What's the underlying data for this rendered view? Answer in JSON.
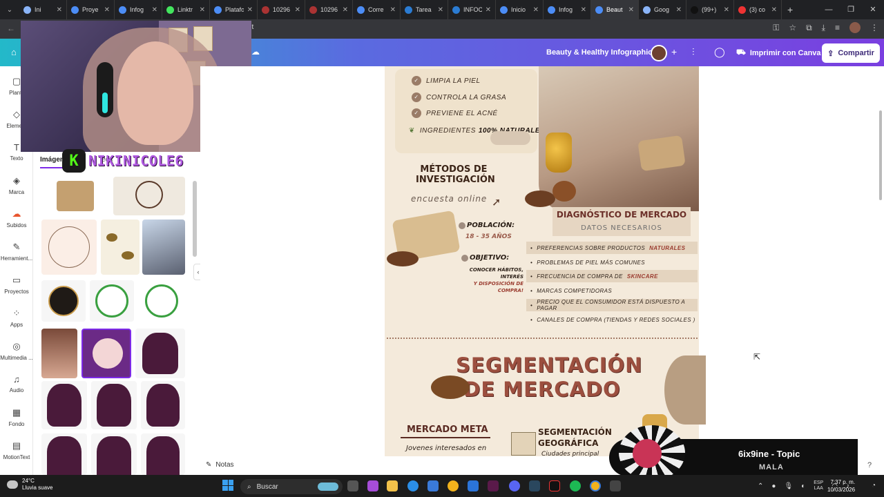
{
  "browser": {
    "tabs": [
      {
        "label": "Ini",
        "color": "#8ab4f8",
        "active": false
      },
      {
        "label": "Proye",
        "color": "#4c8df6",
        "active": false
      },
      {
        "label": "Infog",
        "color": "#4c8df6",
        "active": false
      },
      {
        "label": "Linktr",
        "color": "#43e55e",
        "active": false
      },
      {
        "label": "Platafo",
        "color": "#4c8df6",
        "active": false
      },
      {
        "label": "10296",
        "color": "#a33",
        "active": false
      },
      {
        "label": "10296",
        "color": "#a33",
        "active": false
      },
      {
        "label": "Corre",
        "color": "#4c8df6",
        "active": false
      },
      {
        "label": "Tarea",
        "color": "#2b7cd3",
        "active": false
      },
      {
        "label": "INFOC",
        "color": "#2b7cd3",
        "active": false
      },
      {
        "label": "Inicio",
        "color": "#4c8df6",
        "active": false
      },
      {
        "label": "Infog",
        "color": "#4c8df6",
        "active": false
      },
      {
        "label": "Beaut",
        "color": "#4c8df6",
        "active": true
      },
      {
        "label": "Goog",
        "color": "#8ab4f8",
        "active": false
      },
      {
        "label": "(99+)",
        "color": "#111",
        "active": false
      },
      {
        "label": "(3) co",
        "color": "#e33",
        "active": false
      }
    ],
    "url_fragment": "lit"
  },
  "canva": {
    "title": "Beauty & Healthy Infographic",
    "print_label": "Imprimir con Canva",
    "share_label": "Compartir",
    "notes_label": "Notas"
  },
  "rail": {
    "items": [
      {
        "name": "plantillas",
        "label": "Plantil",
        "icon": "▢"
      },
      {
        "name": "elementos",
        "label": "Element",
        "icon": "◇"
      },
      {
        "name": "texto",
        "label": "Texto",
        "icon": "T"
      },
      {
        "name": "marca",
        "label": "Marca",
        "icon": "◈"
      },
      {
        "name": "subidos",
        "label": "Subidos",
        "icon": "☁"
      },
      {
        "name": "herramientas",
        "label": "Herramient...",
        "icon": "✎"
      },
      {
        "name": "proyectos",
        "label": "Proyectos",
        "icon": "▭"
      },
      {
        "name": "apps",
        "label": "Apps",
        "icon": "⁘"
      },
      {
        "name": "multimedia",
        "label": "Multimedia ...",
        "icon": "◎"
      },
      {
        "name": "audio",
        "label": "Audio",
        "icon": "♫"
      },
      {
        "name": "fondo",
        "label": "Fondo",
        "icon": "▦"
      },
      {
        "name": "motiontext",
        "label": "MotionText",
        "icon": "▤"
      }
    ]
  },
  "stream": {
    "badge": "K",
    "name": "NIKINICOLE6"
  },
  "panel": {
    "tabs": [
      "Imágen",
      "eos"
    ]
  },
  "infographic": {
    "benefits": [
      "LIMPIA LA PIEL",
      "CONTROLA LA GRASA",
      "PREVIENE EL ACNÉ"
    ],
    "ingredients": "INGREDIENTES",
    "ingredients_bold": "100% NATURALES",
    "methods_title": "MÉTODOS DE INVESTIGACIÓN",
    "methods_sub": "encuesta online",
    "diag_title": "DIAGNÓSTICO DE MERCADO",
    "diag_sub": "DATOS NECESARIOS",
    "population_label": "POBLACIÓN:",
    "population_value": "18 - 35 AÑOS",
    "objective_label": "OBJETIVO:",
    "objective_value": "CONOCER HÁBITOS, INTERÉS",
    "objective_value_hl": "Y DISPOSICIÓN DE COMPRA!",
    "needs": [
      {
        "text": "PREFERENCIAS SOBRE PRODUCTOS",
        "hl": "NATURALES"
      },
      {
        "text": "PROBLEMAS DE PIEL MÁS COMUNES",
        "hl": ""
      },
      {
        "text": "FRECUENCIA DE COMPRA DE",
        "hl": "SKINCARE"
      },
      {
        "text": "MARCAS COMPETIDORAS",
        "hl": ""
      },
      {
        "text": "PRECIO QUE EL CONSUMIDOR ESTÁ DISPUESTO A PAGAR",
        "hl": ""
      },
      {
        "text": "CANALES DE COMPRA (TIENDAS Y REDES SOCIALES )",
        "hl": ""
      }
    ],
    "segment_title_1": "SEGMENTACIÓN",
    "segment_title_2": "DE MERCADO",
    "meta_title": "MERCADO META",
    "meta_text": "Jovenes interesados en",
    "geo_title_1": "SEGMENTACIÓN",
    "geo_title_2": "GEOGRÁFICA",
    "geo_text": "Ciudades principal"
  },
  "media": {
    "track": "6ix9ine - Topic",
    "artist": "MALA"
  },
  "taskbar": {
    "weather_temp": "24°C",
    "weather_desc": "Lluvia suave",
    "search_placeholder": "Buscar",
    "lang_top": "ESP",
    "lang_bottom": "LAA",
    "time": "7:37 p. m.",
    "date": "10/03/2026"
  }
}
